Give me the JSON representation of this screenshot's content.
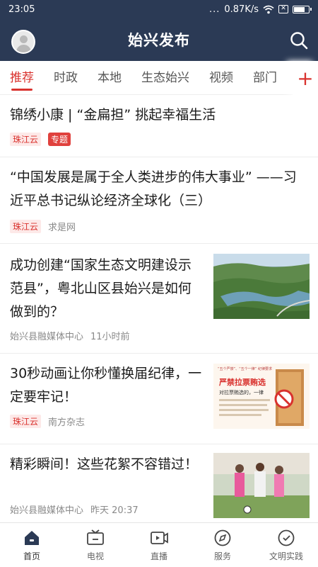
{
  "status": {
    "time": "23:05",
    "dots": "...",
    "speed": "0.87K/s",
    "battery_level": 0.8
  },
  "header": {
    "title": "始兴发布"
  },
  "tabs": [
    "推荐",
    "时政",
    "本地",
    "生态始兴",
    "视频",
    "部门"
  ],
  "tab_add_symbol": "+",
  "feed": [
    {
      "title": "锦绣小康 | “金扁担” 挑起幸福生活",
      "source": "珠江云",
      "badge": "专题"
    },
    {
      "title": "“中国发展是属于全人类进步的伟大事业” ——习近平总书记纵论经济全球化（三）",
      "source": "珠江云",
      "origin": "求是网"
    },
    {
      "title": "成功创建“国家生态文明建设示范县”，粤北山区县始兴是如何做到的？",
      "source": "始兴县融媒体中心",
      "time": "11小时前",
      "image": "aerial-reservoir-landscape"
    },
    {
      "title": "30秒动画让你秒懂换届纪律，一定要牢记！",
      "source": "珠江云",
      "origin": "南方杂志",
      "image": "election-discipline-poster",
      "poster_top": "“五个严禁”、“五个一律” 纪律要求",
      "poster_headline": "严禁拉票贿选",
      "poster_sub": "对拉票贿选的，一律"
    },
    {
      "title": "精彩瞬间！这些花絮不容错过！",
      "source": "始兴县融媒体中心",
      "time": "昨天 20:37",
      "image": "kids-football-photo"
    }
  ],
  "bottom_nav": [
    {
      "label": "首页",
      "icon": "home-icon"
    },
    {
      "label": "电视",
      "icon": "tv-icon"
    },
    {
      "label": "直播",
      "icon": "live-video-icon"
    },
    {
      "label": "服务",
      "icon": "compass-icon"
    },
    {
      "label": "文明实践",
      "icon": "practice-icon"
    }
  ],
  "colors": {
    "header_bg": "#2b3a55",
    "accent": "#d9322e"
  }
}
